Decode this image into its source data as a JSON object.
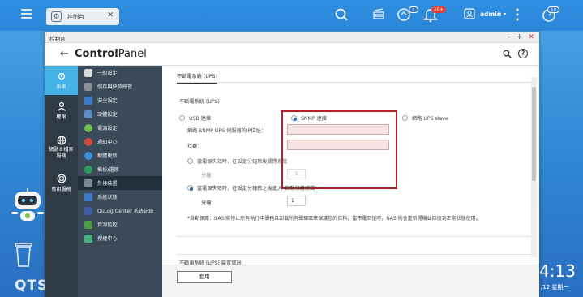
{
  "taskbar": {
    "tab_label": "控制台",
    "tab_close": "✕",
    "user_name": "admin",
    "caret": "▾",
    "badges": {
      "updates": "1",
      "notifications": "10+",
      "info": "10"
    }
  },
  "desktop": {
    "brand": "QTS",
    "clock": "4:13",
    "date": "/12 星期一"
  },
  "window": {
    "title": "控制台",
    "controls": {
      "minimize": "–",
      "maximize": "+",
      "close": "✕"
    },
    "back_arrow": "←",
    "app_title_part1": "Control",
    "app_title_part2": "Panel",
    "help": "?"
  },
  "rail": [
    {
      "label": "系統",
      "active": true
    },
    {
      "label": "權限",
      "active": false
    },
    {
      "label": "網路＆檔案服務",
      "active": false
    },
    {
      "label": "應用服務",
      "active": false
    }
  ],
  "submenu": [
    {
      "label": "一般設定",
      "color": "#d9d9d9"
    },
    {
      "label": "儲存與快照總管",
      "color": "#8a8f96"
    },
    {
      "label": "安全設定",
      "color": "#3a78c8"
    },
    {
      "label": "硬體設定",
      "color": "#5d8fc4"
    },
    {
      "label": "電源設定",
      "color": "#6cc04a"
    },
    {
      "label": "通知中心",
      "color": "#d54a3c"
    },
    {
      "label": "韌體更新",
      "color": "#3b8fd6"
    },
    {
      "label": "備份/還原",
      "color": "#2f9d5b"
    },
    {
      "label": "外接裝置",
      "color": "#7b8a96",
      "active": true
    },
    {
      "label": "系統狀態",
      "color": "#3a78c8"
    },
    {
      "label": "QuLog Center 系統記錄",
      "color": "#3a5fa8"
    },
    {
      "label": "資源監控",
      "color": "#4aa040"
    },
    {
      "label": "授權中心",
      "color": "#49b37b"
    }
  ],
  "content": {
    "tab": "不斷電系統 (UPS)",
    "section_title": "不斷電系統 (UPS)",
    "opt_usb": "USB 連接",
    "opt_snmp": "SNMP 連接",
    "opt_slave": "網路 UPS slave",
    "snmp_ip_label": "網路 SNMP UPS 伺服器的IP位址：",
    "community_label": "社群：",
    "snmp_ip_value": "",
    "community_value": "",
    "opt_shutdown": "當電源失效時，在設定分鐘數後關閉系統",
    "opt_standby": "當電源失效時，在設定分鐘數之後進入\"自動保護模式\"",
    "minutes_label": "分鐘：",
    "minutes_disabled": "5",
    "minutes_value": "1",
    "note": "*自動保護：NAS 將停止所有執行中服務且卸載所有磁碟區來保護您的資料，當市電回復時，NAS 則會重新開機並回復到正常狀態使用。",
    "section2_title": "不斷電系統 (UPS) 裝置資訊",
    "apply": "套用"
  }
}
